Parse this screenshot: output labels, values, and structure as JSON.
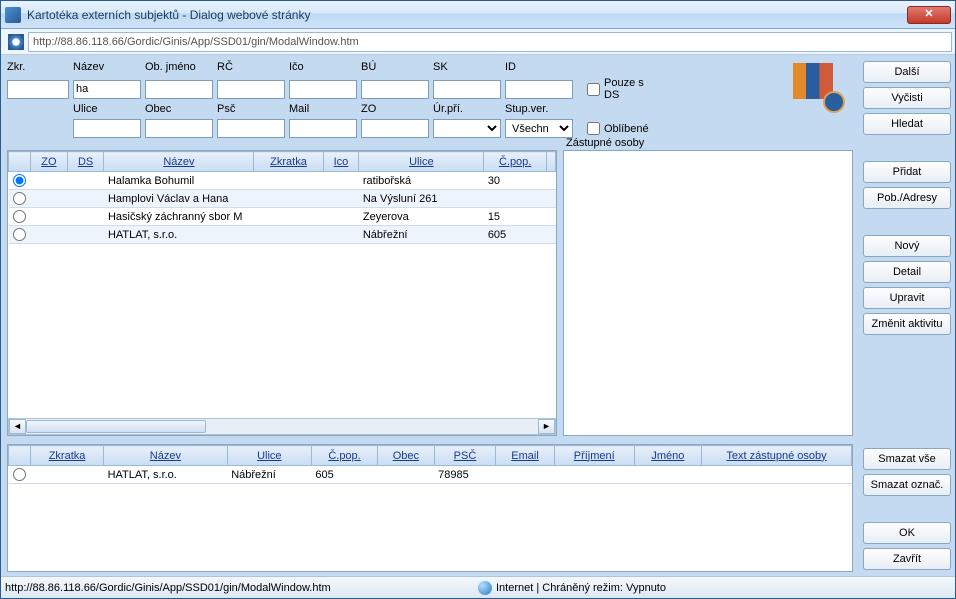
{
  "window": {
    "title": "Kartotéka externích subjektů - Dialog webové stránky"
  },
  "address": {
    "url": "http://88.86.118.66/Gordic/Ginis/App/SSD01/gin/ModalWindow.htm"
  },
  "filters": {
    "row1": {
      "zkr": "Zkr.",
      "nazev": "Název",
      "objmeno": "Ob. jméno",
      "rc": "RČ",
      "ico": "Ičo",
      "bu": "BÚ",
      "sk": "SK",
      "id": "ID"
    },
    "row2": {
      "ulice": "Ulice",
      "obec": "Obec",
      "psc": "Psč",
      "mail": "Mail",
      "zo": "ZO",
      "urpri": "Úr.pří.",
      "stupver": "Stup.ver."
    },
    "values": {
      "nazev": "ha",
      "stupver": "Všechn"
    },
    "checkboxes": {
      "pouzeds": "Pouze s DS",
      "oblibene": "Oblíbené"
    }
  },
  "mainTable": {
    "headers": {
      "zo": "ZO",
      "ds": "DS",
      "nazev": "Název",
      "zkratka": "Zkratka",
      "ico": "Ico",
      "ulice": "Ulice",
      "cpop": "Č.pop."
    },
    "rows": [
      {
        "selected": true,
        "nazev": "Halamka Bohumil",
        "zkratka": "",
        "ico": "",
        "ulice": "ratibořská",
        "cpop": "30"
      },
      {
        "selected": false,
        "nazev": "Hamplovi Václav a Hana",
        "zkratka": "",
        "ico": "",
        "ulice": "Na Výsluní 261",
        "cpop": ""
      },
      {
        "selected": false,
        "nazev": "Hasičský záchranný sbor M",
        "zkratka": "",
        "ico": "",
        "ulice": "Zeyerova",
        "cpop": "15"
      },
      {
        "selected": false,
        "nazev": "HATLAT, s.r.o.",
        "zkratka": "",
        "ico": "",
        "ulice": "Nábřežní",
        "cpop": "605"
      }
    ]
  },
  "zastupne": {
    "caption": "Zástupné osoby"
  },
  "bottomTable": {
    "headers": {
      "zkratka": "Zkratka",
      "nazev": "Název",
      "ulice": "Ulice",
      "cpop": "Č.pop.",
      "obec": "Obec",
      "psc": "PSČ",
      "email": "Email",
      "prijmeni": "Příjmení",
      "jmeno": "Jméno",
      "textzo": "Text zástupné osoby"
    },
    "rows": [
      {
        "zkratka": "",
        "nazev": "HATLAT, s.r.o.",
        "ulice": "Nábřežní",
        "cpop": "605",
        "obec": "",
        "psc": "78985",
        "email": "",
        "prijmeni": "",
        "jmeno": "",
        "textzo": ""
      }
    ]
  },
  "buttons": {
    "dalsi": "Další",
    "vycisti": "Vyčisti",
    "hledat": "Hledat",
    "pridat": "Přidat",
    "pobadresy": "Pob./Adresy",
    "novy": "Nový",
    "detail": "Detail",
    "upravit": "Upravit",
    "zmenitakt": "Změnit aktivitu",
    "smazatvse": "Smazat vše",
    "smazatoznac": "Smazat označ.",
    "ok": "OK",
    "zavrit": "Zavřít"
  },
  "statusbar": {
    "url": "http://88.86.118.66/Gordic/Ginis/App/SSD01/gin/ModalWindow.htm",
    "zone": "Internet | Chráněný režim: Vypnuto"
  }
}
